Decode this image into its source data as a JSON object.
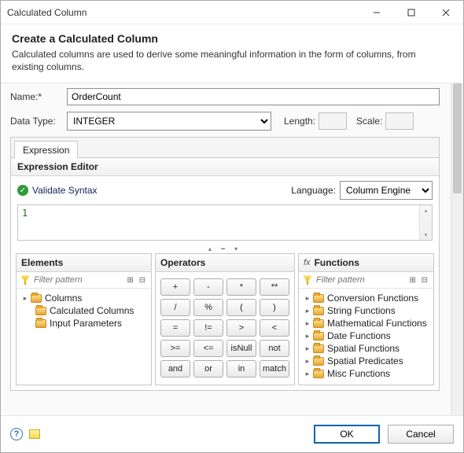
{
  "window": {
    "title": "Calculated Column"
  },
  "header": {
    "heading": "Create a Calculated Column",
    "desc": "Calculated columns are used to derive some meaningful information in the form of columns, from existing columns."
  },
  "form": {
    "name_label": "Name:*",
    "name_value": "OrderCount",
    "datatype_label": "Data Type:",
    "datatype_value": "INTEGER",
    "length_label": "Length:",
    "scale_label": "Scale:"
  },
  "tabs": {
    "expression": "Expression"
  },
  "editor": {
    "title": "Expression Editor",
    "validate": "Validate Syntax",
    "language_label": "Language:",
    "language_value": "Column Engine",
    "text": "1"
  },
  "elements": {
    "title": "Elements",
    "filter_placeholder": "Filter pattern",
    "items": [
      "Columns",
      "Calculated Columns",
      "Input Parameters"
    ]
  },
  "operators": {
    "title": "Operators",
    "buttons": [
      "+",
      "-",
      "*",
      "**",
      "/",
      "%",
      "(",
      ")",
      "=",
      "!=",
      ">",
      "<",
      ">=",
      "<=",
      "isNull",
      "not",
      "and",
      "or",
      "in",
      "match"
    ]
  },
  "functions": {
    "title": "Functions",
    "filter_placeholder": "Filter pattern",
    "items": [
      "Conversion Functions",
      "String Functions",
      "Mathematical Functions",
      "Date Functions",
      "Spatial Functions",
      "Spatial Predicates",
      "Misc Functions"
    ]
  },
  "footer": {
    "ok": "OK",
    "cancel": "Cancel"
  }
}
